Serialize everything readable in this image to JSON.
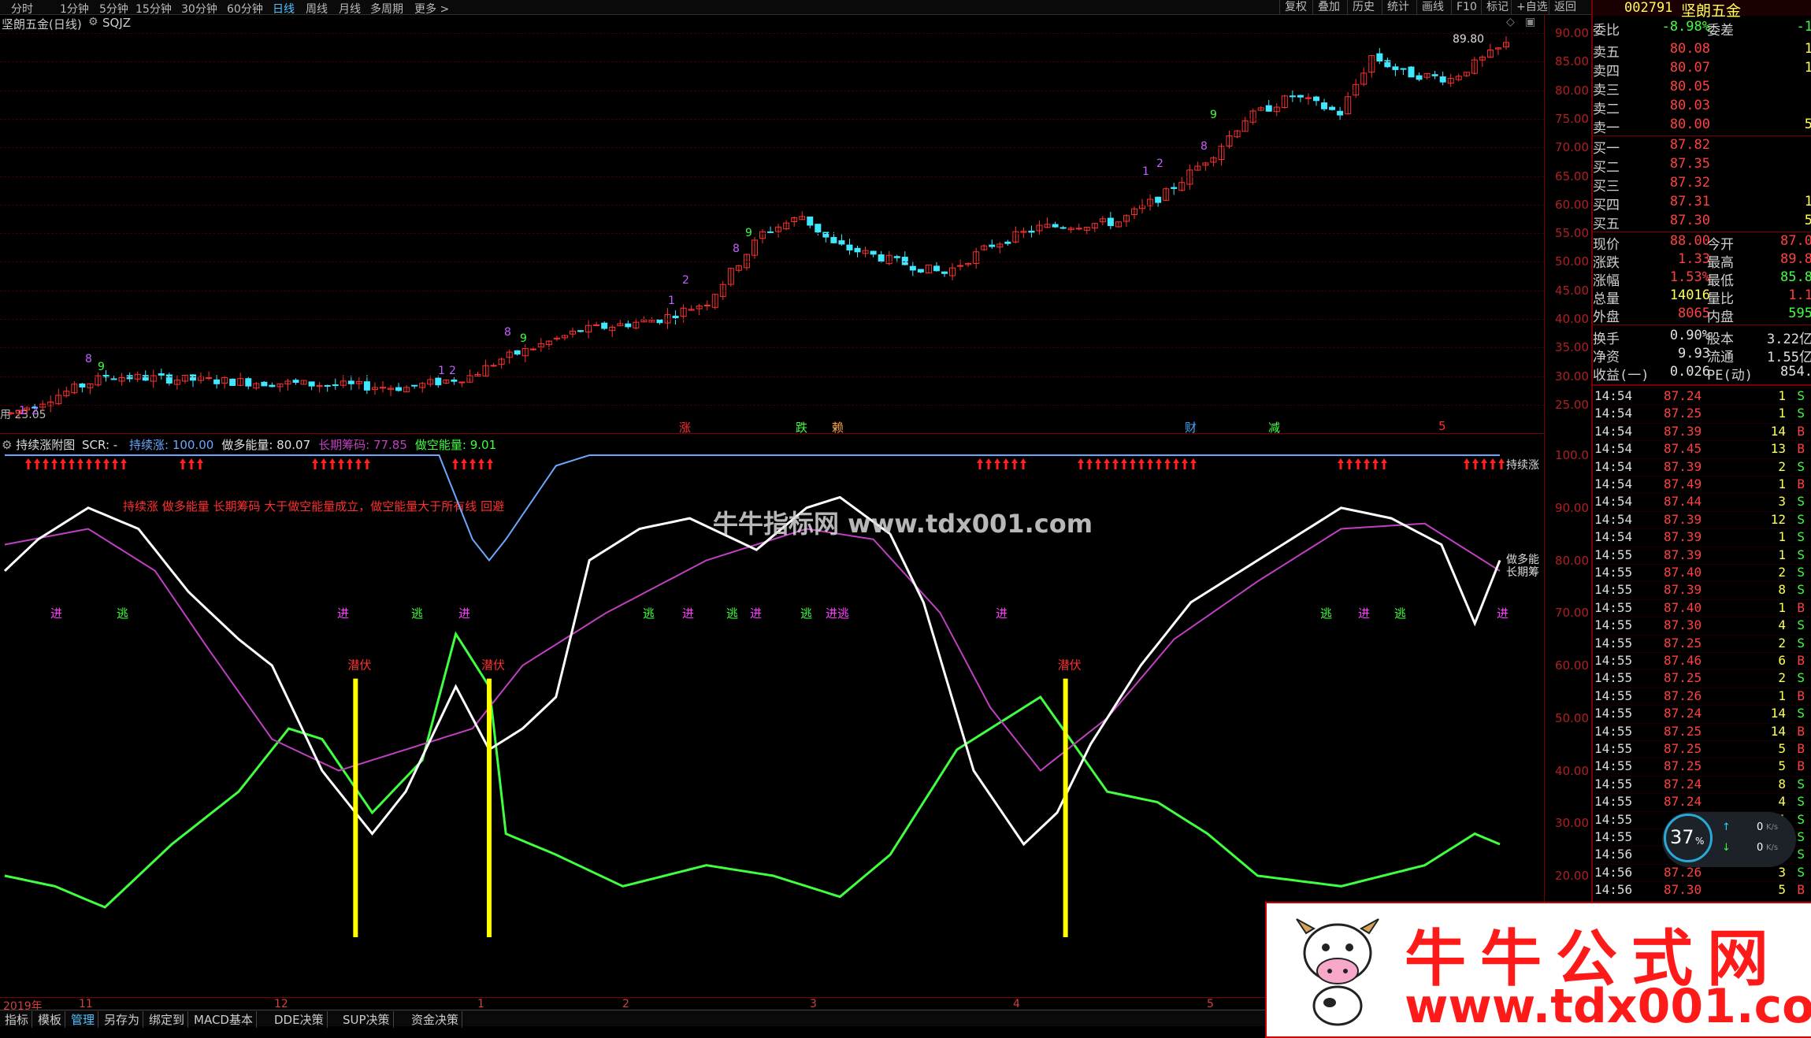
{
  "toolbar": {
    "periods": [
      "分时",
      "1分钟",
      "5分钟",
      "15分钟",
      "30分钟",
      "60分钟",
      "日线",
      "周线",
      "月线",
      "多周期",
      "更多 >"
    ],
    "active_period": "日线",
    "right_buttons": [
      "复权",
      "叠加",
      "历史",
      "统计",
      "画线",
      "F10",
      "标记",
      "+自选",
      "返回"
    ]
  },
  "main_chart": {
    "title": "坚朗五金(日线)",
    "indicator": "SQJZ",
    "high_label": "89.80",
    "bottom_label": "用 23.05",
    "signal_marks": [
      {
        "text": "涨",
        "color": "#ff3030"
      },
      {
        "text": "跌",
        "color": "#40ff40"
      },
      {
        "text": "赖",
        "color": "#ffaa44"
      },
      {
        "text": "财",
        "color": "#4aa8ff"
      },
      {
        "text": "减",
        "color": "#40ff40"
      },
      {
        "text": "5",
        "color": "#ff3030"
      }
    ],
    "td_marks": [
      "1",
      "2",
      "8",
      "9",
      "1",
      "2",
      "8",
      "9",
      "1",
      "2",
      "8",
      "9",
      "1",
      "2",
      "8",
      "9",
      "2",
      "8",
      "9"
    ]
  },
  "price_axis": {
    "labels": [
      "90.00",
      "85.00",
      "80.00",
      "75.00",
      "70.00",
      "65.00",
      "60.00",
      "55.00",
      "50.00",
      "45.00",
      "40.00",
      "35.00",
      "30.00",
      "25.00"
    ]
  },
  "sub_chart": {
    "title": "持续涨附图",
    "scr_label": "SCR: -",
    "series_readout": [
      {
        "name": "持续涨",
        "value": "100.00",
        "color": "#6aa8ff"
      },
      {
        "name": "做多能量",
        "value": "80.07",
        "color": "#e0e0e0"
      },
      {
        "name": "长期筹码",
        "value": "77.85",
        "color": "#c040c0"
      },
      {
        "name": "做空能量",
        "value": "9.01",
        "color": "#40ff40"
      }
    ],
    "note": "持续涨 做多能量 长期筹码 大于做空能量成立，做空能量大于所有线 回避",
    "right_labels": [
      "持续涨",
      "做多能",
      "长期筹"
    ],
    "signals": [
      {
        "text": "进",
        "color": "#ff40ff"
      },
      {
        "text": "逃",
        "color": "#40ff40"
      },
      {
        "text": "进",
        "color": "#ff40ff"
      },
      {
        "text": "逃",
        "color": "#40ff40"
      },
      {
        "text": "进",
        "color": "#ff40ff"
      },
      {
        "text": "逃",
        "color": "#40ff40"
      },
      {
        "text": "进",
        "color": "#ff40ff"
      },
      {
        "text": "逃",
        "color": "#40ff40"
      },
      {
        "text": "进",
        "color": "#ff40ff"
      },
      {
        "text": "逃",
        "color": "#40ff40"
      },
      {
        "text": "进逃",
        "color": "#ff40ff"
      },
      {
        "text": "进",
        "color": "#ff40ff"
      },
      {
        "text": "逃",
        "color": "#40ff40"
      },
      {
        "text": "进",
        "color": "#ff40ff"
      },
      {
        "text": "逃",
        "color": "#40ff40"
      },
      {
        "text": "进",
        "color": "#ff40ff"
      }
    ],
    "ambush_label": "潜伏",
    "axis": [
      "100.0",
      "90.00",
      "80.00",
      "70.00",
      "60.00",
      "50.00",
      "40.00",
      "30.00",
      "20.00"
    ]
  },
  "date_axis": [
    "2019年",
    "11",
    "12",
    "1",
    "2",
    "3",
    "4",
    "5"
  ],
  "bottom_tabs": [
    "指标",
    "模板",
    "管理",
    "另存为",
    "绑定到",
    "MACD基本",
    "DDE决策",
    "SUP决策",
    "资金决策"
  ],
  "bottom_tab_active": "管理",
  "side": {
    "code": "002791",
    "name": "坚朗五金",
    "ratio": {
      "label": "委比",
      "value": "-8.98%",
      "label2": "委差",
      "value2": "-1"
    },
    "asks": [
      {
        "label": "卖五",
        "price": "80.08",
        "vol": "1"
      },
      {
        "label": "卖四",
        "price": "80.07",
        "vol": "1"
      },
      {
        "label": "卖三",
        "price": "80.05",
        "vol": ""
      },
      {
        "label": "卖二",
        "price": "80.03",
        "vol": ""
      },
      {
        "label": "卖一",
        "price": "80.00",
        "vol": "5"
      }
    ],
    "bids": [
      {
        "label": "买一",
        "price": "87.82",
        "vol": ""
      },
      {
        "label": "买二",
        "price": "87.35",
        "vol": ""
      },
      {
        "label": "买三",
        "price": "87.32",
        "vol": ""
      },
      {
        "label": "买四",
        "price": "87.31",
        "vol": "1"
      },
      {
        "label": "买五",
        "price": "87.30",
        "vol": "5"
      }
    ],
    "stats": [
      {
        "l1": "现价",
        "v1": "88.00",
        "c1": "red",
        "l2": "今开",
        "v2": "87.0",
        "c2": "red"
      },
      {
        "l1": "涨跌",
        "v1": "1.33",
        "c1": "red",
        "l2": "最高",
        "v2": "89.8",
        "c2": "red"
      },
      {
        "l1": "涨幅",
        "v1": "1.53%",
        "c1": "red",
        "l2": "最低",
        "v2": "85.8",
        "c2": "green"
      },
      {
        "l1": "总量",
        "v1": "14016",
        "c1": "yellow",
        "l2": "量比",
        "v2": "1.1",
        "c2": "red"
      },
      {
        "l1": "外盘",
        "v1": "8065",
        "c1": "red",
        "l2": "内盘",
        "v2": "595",
        "c2": "green"
      }
    ],
    "stats2": [
      {
        "l1": "换手",
        "v1": "0.90%",
        "l2": "股本",
        "v2": "3.22亿"
      },
      {
        "l1": "净资",
        "v1": "9.93",
        "l2": "流通",
        "v2": "1.55亿"
      },
      {
        "l1": "收益(一)",
        "v1": "0.026",
        "l2": "PE(动)",
        "v2": "854."
      }
    ],
    "ticks": [
      {
        "t": "14:54",
        "p": "87.24",
        "v": "1",
        "s": "S"
      },
      {
        "t": "14:54",
        "p": "87.25",
        "v": "1",
        "s": "S"
      },
      {
        "t": "14:54",
        "p": "87.39",
        "v": "14",
        "s": "B"
      },
      {
        "t": "14:54",
        "p": "87.45",
        "v": "13",
        "s": "B"
      },
      {
        "t": "14:54",
        "p": "87.39",
        "v": "2",
        "s": "S"
      },
      {
        "t": "14:54",
        "p": "87.49",
        "v": "1",
        "s": "B"
      },
      {
        "t": "14:54",
        "p": "87.44",
        "v": "3",
        "s": "S"
      },
      {
        "t": "14:54",
        "p": "87.39",
        "v": "12",
        "s": "S"
      },
      {
        "t": "14:54",
        "p": "87.39",
        "v": "1",
        "s": "S"
      },
      {
        "t": "14:55",
        "p": "87.39",
        "v": "1",
        "s": "S"
      },
      {
        "t": "14:55",
        "p": "87.40",
        "v": "2",
        "s": "S"
      },
      {
        "t": "14:55",
        "p": "87.39",
        "v": "8",
        "s": "S"
      },
      {
        "t": "14:55",
        "p": "87.40",
        "v": "1",
        "s": "B"
      },
      {
        "t": "14:55",
        "p": "87.30",
        "v": "4",
        "s": "S"
      },
      {
        "t": "14:55",
        "p": "87.25",
        "v": "2",
        "s": "S"
      },
      {
        "t": "14:55",
        "p": "87.46",
        "v": "6",
        "s": "B"
      },
      {
        "t": "14:55",
        "p": "87.25",
        "v": "2",
        "s": "S"
      },
      {
        "t": "14:55",
        "p": "87.26",
        "v": "1",
        "s": "B"
      },
      {
        "t": "14:55",
        "p": "87.24",
        "v": "14",
        "s": "S"
      },
      {
        "t": "14:55",
        "p": "87.25",
        "v": "14",
        "s": "B"
      },
      {
        "t": "14:55",
        "p": "87.25",
        "v": "5",
        "s": "B"
      },
      {
        "t": "14:55",
        "p": "87.25",
        "v": "5",
        "s": "B"
      },
      {
        "t": "14:55",
        "p": "87.24",
        "v": "8",
        "s": "S"
      },
      {
        "t": "14:55",
        "p": "87.24",
        "v": "4",
        "s": "S"
      },
      {
        "t": "14:55",
        "p": "",
        "v": "1",
        "s": "S"
      },
      {
        "t": "14:55",
        "p": "",
        "v": "1",
        "s": "S"
      },
      {
        "t": "14:56",
        "p": "",
        "v": "1",
        "s": "S"
      },
      {
        "t": "14:56",
        "p": "87.26",
        "v": "3",
        "s": "S"
      },
      {
        "t": "14:56",
        "p": "87.30",
        "v": "5",
        "s": "B"
      }
    ],
    "gauge": {
      "percent": "37",
      "unit": "%",
      "up": "0",
      "down": "0",
      "rate_unit": "K/s"
    }
  },
  "watermark": {
    "center": "牛牛指标网 www.tdx001.com",
    "banner_title": "牛牛公式网",
    "banner_url": "www.tdx001.com"
  },
  "colors": {
    "up": "#ff3030",
    "down": "#40e8ff",
    "bull_line": "#ffffff",
    "chip_line": "#c040c0",
    "bear_line": "#40ff40",
    "signal": "#ffff00",
    "grid": "#7a0000"
  }
}
